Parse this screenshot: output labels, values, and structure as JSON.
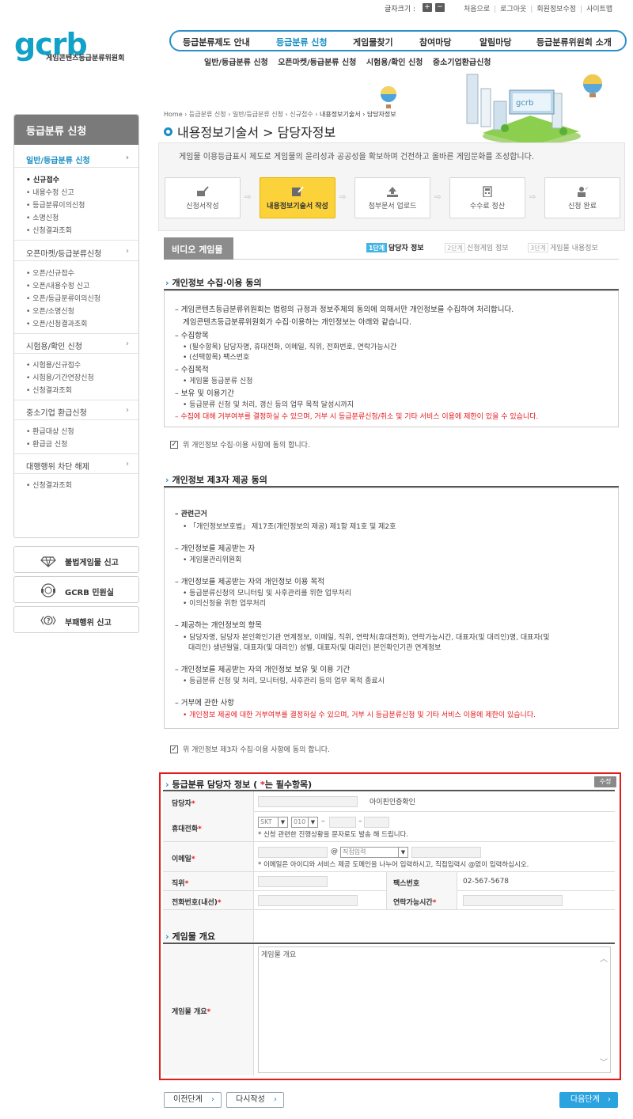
{
  "util": {
    "font_size_label": "글자크기 :",
    "plus": "+",
    "minus": "−",
    "links": [
      "처음으로",
      "로그아웃",
      "회원정보수정",
      "사이트맵"
    ]
  },
  "logo": {
    "word": "gcrb",
    "sub": "게임콘텐츠등급분류위원회"
  },
  "gnb": [
    "등급분류제도 안내",
    "등급분류 신청",
    "게임물찾기",
    "참여마당",
    "알림마당",
    "등급분류위원회 소개"
  ],
  "subgnb": [
    "일반/등급분류 신청",
    "오픈마켓/등급분류 신청",
    "시험용/확인 신청",
    "중소기업환급신청"
  ],
  "breadcrumb": {
    "path": "Home  › 등급분류 신청  › 일반/등급분류 신청  › 신규접수  › ",
    "current": "내용정보기술서 › 담당자정보"
  },
  "page_title": "내용정보기술서 > 담당자정보",
  "lnav": {
    "head": "등급분류 신청",
    "groups": [
      {
        "label": "일반/등급분류 신청",
        "subs": [
          "신규접수",
          "내용수정 신고",
          "등급분류이의신청",
          "소명신청",
          "신청결과조회"
        ]
      },
      {
        "label": "오픈마켓/등급분류신청",
        "subs": [
          "오픈/신규접수",
          "오픈/내용수정 신고",
          "오픈/등급분류이의신청",
          "오픈/소명신청",
          "오픈/신청결과조회"
        ]
      },
      {
        "label": "시험용/확인 신청",
        "subs": [
          "시험용/신규접수",
          "시험용/기간연장신청",
          "신청결과조회"
        ]
      },
      {
        "label": "중소기업 환급신청",
        "subs": [
          "환급대상 신청",
          "환급금 신청"
        ]
      },
      {
        "label": "대행행위 차단 해제",
        "subs": [
          "신청결과조회"
        ]
      }
    ]
  },
  "quick": [
    "불법게임물 신고",
    "GCRB 민원실",
    "부패행위 신고"
  ],
  "intro": "게임물 이용등급표시 제도로 게임물의 윤리성과 공공성을 확보하며 건전하고 올바른 게임문화를 조성합니다.",
  "steps": [
    "신청서작성",
    "내용정보기술서 작성",
    "첨부문서 업로드",
    "수수료 정산",
    "신청 완료"
  ],
  "tabbar": {
    "type": "비디오 게임물",
    "substeps": [
      {
        "num": "1단계",
        "label": "담당자 정보"
      },
      {
        "num": "2단계",
        "label": "신청게임 정보"
      },
      {
        "num": "3단계",
        "label": "게임물 내용정보"
      }
    ]
  },
  "privacy1": {
    "title": "개인정보 수집·이용 동의",
    "lines": [
      "–  게임콘텐츠등급분류위원회는 법령의 규정과 정보주체의 동의에 의해서만 개인정보를 수집하여 처리합니다.",
      "게임콘텐츠등급분류위원회가 수집·이용하는 개인정보는 아래와 같습니다.",
      "–  수집항목",
      "•  (필수항목) 담당자명, 휴대전화, 이메일, 직위, 전화번호, 연락가능시간",
      "•  (선택항목) 팩스번호",
      "–  수집목적",
      "•  게임물 등급분류 신청",
      "–  보유 및 이용기간",
      "•  등급분류 신청 및 처리, 갱신 등의 업무 목적 달성시까지",
      "–  수집에 대해 거부여부를 결정하실 수 있으며, 거부 시 등급분류신청/취소 및 기타 서비스 이용에 제한이 있을 수 있습니다."
    ],
    "agree": "위 개인정보 수집·이용 사항에 동의 합니다."
  },
  "privacy2": {
    "title": "개인정보 제3자 제공 동의",
    "lines": [
      "–  관련근거",
      "•  「개인정보보호법」 제17조(개인정보의 제공) 제1항 제1호 및 제2호",
      "–  개인정보를 제공받는 자",
      "•  게임물관리위원회",
      "–  개인정보를 제공받는 자의 개인정보 이용 목적",
      "•  등급분류신청의 모니터링 및 사후관리를 위한 업무처리",
      "•  이의신청을 위한 업무처리",
      "–  제공하는 개인정보의 항목",
      "•  담당자명, 담당자 본인확인기관 연계정보, 이메일, 직위, 연락처(휴대전화), 연락가능시간, 대표자(및 대리인)명, 대표자(및",
      "대리인) 생년월일, 대표자(및 대리인) 성별, 대표자(및 대리인) 본인확인기관 연계정보",
      "–  개인정보를 제공받는 자의 개인정보 보유 및 이용 기간",
      "•  등급분류 신청 및 처리, 모니터링, 사후관리 등의 업무 목적 종료시",
      "–  거부에 관한 사항",
      "•  개인정보 제공에 대한 거부여부를 결정하실 수 있으며, 거부 시 등급분류신청 및 기타 서비스 이용에 제한이 있습니다."
    ],
    "agree": "위 개인정보 제3자 수집·이용 사항에 동의 합니다."
  },
  "form": {
    "title_pre": "등급분류 담당자 정보 ( ",
    "star": "*",
    "title_post": "는 필수항목)",
    "edit": "수정",
    "manager_label": "담당자",
    "verify": "아이핀인증확인",
    "phone_label": "휴대전화",
    "carrier": "SKT",
    "prefix": "010",
    "dash": "–",
    "phone_note": "* 신청 관련한 진행상황을 문자로도 발송 해 드립니다.",
    "email_label": "이메일",
    "at": "@",
    "domain_select": "직접입력",
    "email_note": "* 이메일은 아이디와 서비스 제공 도메인을 나누어 입력하시고, 직접입력시 @없이 입력하십시오.",
    "position_label": "직위",
    "fax_label": "팩스번호",
    "fax_value": "02-567-5678",
    "tel_label": "전화번호(내선)",
    "contact_time_label": "연락가능시간",
    "overview_title": "게임물 개요",
    "overview_label": "게임물 개요",
    "overview_placeholder": "게임물 개요"
  },
  "buttons": {
    "prev": "이전단계",
    "reset": "다시작성",
    "next": "다음단계"
  }
}
